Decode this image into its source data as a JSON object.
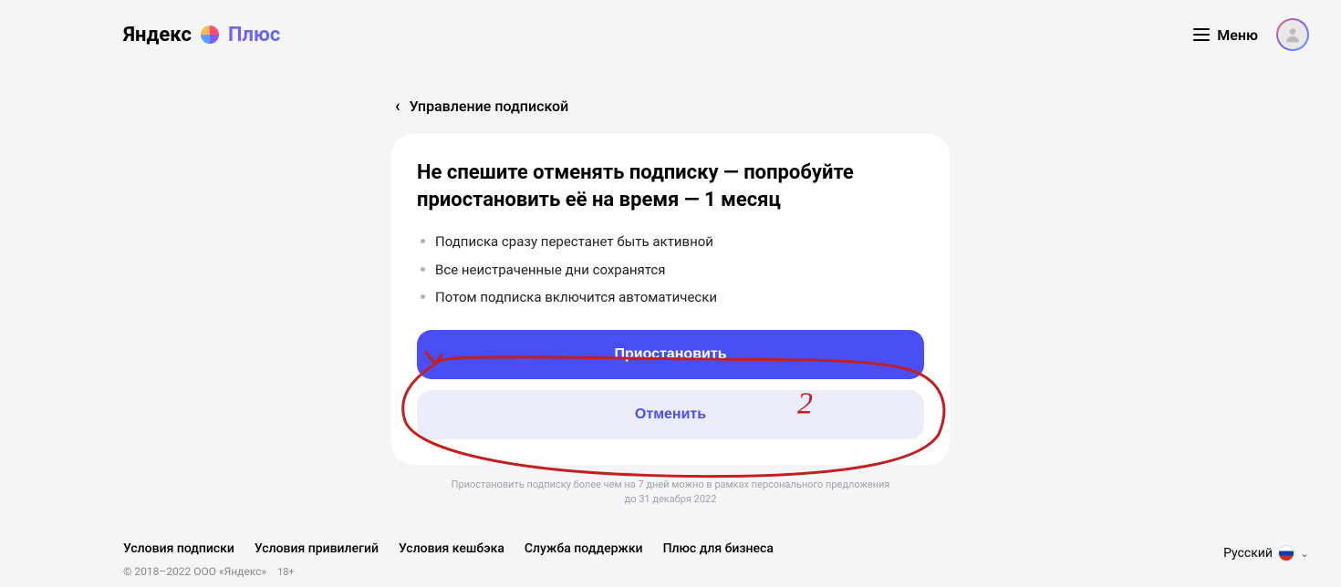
{
  "header": {
    "logo_yandex": "Яндекс",
    "logo_plus": "Плюс",
    "menu_label": "Меню"
  },
  "breadcrumb": {
    "label": "Управление подпиской"
  },
  "card": {
    "title": "Не спешите отменять подписку — попробуйте приостановить её на время — 1 месяц",
    "features": [
      "Подписка сразу перестанет быть активной",
      "Все неистраченные дни сохранятся",
      "Потом подписка включится автоматически"
    ],
    "pause_button": "Приостановить",
    "cancel_button": "Отменить"
  },
  "note": {
    "line1": "Приостановить подписку более чем на 7 дней можно в рамках персонального предложения",
    "line2": "до 31 декабря 2022"
  },
  "footer": {
    "links": [
      "Условия подписки",
      "Условия привилегий",
      "Условия кешбэка",
      "Служба поддержки",
      "Плюс для бизнеса"
    ],
    "copyright": "© 2018–2022 ООО «Яндекс»",
    "age": "18+",
    "language": "Русский"
  },
  "annotation": {
    "number": "2"
  }
}
